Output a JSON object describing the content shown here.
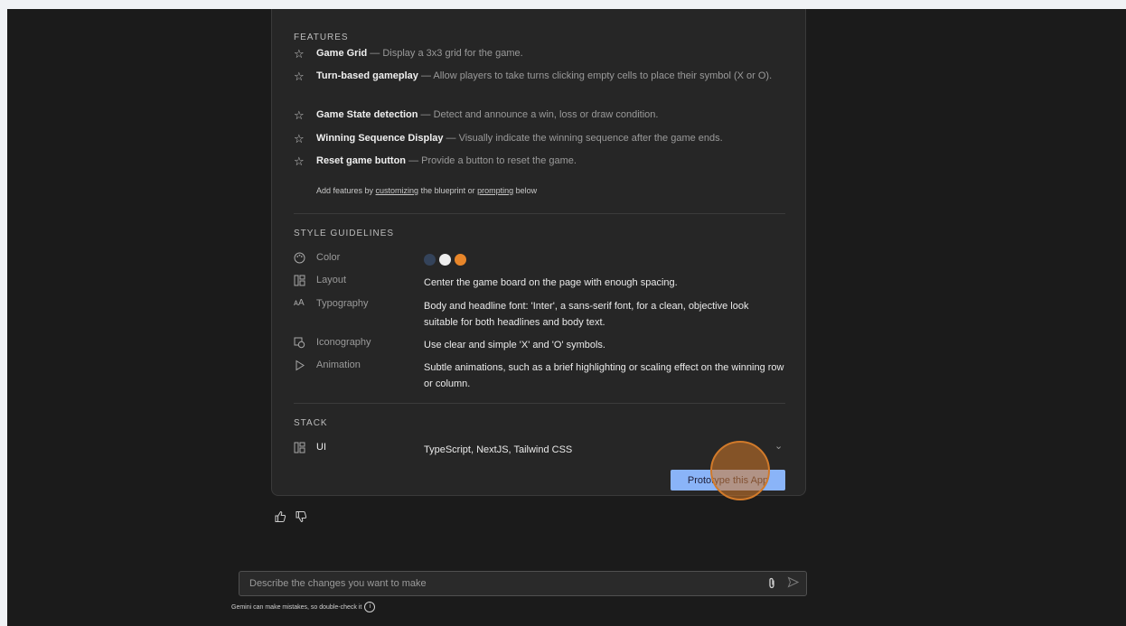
{
  "features": {
    "title": "FEATURES",
    "items": [
      {
        "name": "Game Grid",
        "desc": " — Display a 3x3 grid for the game."
      },
      {
        "name": "Turn-based gameplay",
        "desc": " — Allow players to take turns clicking empty cells to place their symbol (X or O)."
      },
      {
        "name": "Game State detection",
        "desc": " — Detect and announce a win, loss or draw condition."
      },
      {
        "name": "Winning Sequence Display",
        "desc": " — Visually indicate the winning sequence after the game ends."
      },
      {
        "name": "Reset game button",
        "desc": " — Provide a button to reset the game."
      }
    ],
    "hint_prefix": "Add features by ",
    "hint_link1": "customizing",
    "hint_middle": " the blueprint or ",
    "hint_link2": "prompting",
    "hint_suffix": " below"
  },
  "style": {
    "title": "STYLE GUIDELINES",
    "color_label": "Color",
    "colors": [
      "#34435a",
      "#eeeeee",
      "#e8862a"
    ],
    "layout_label": "Layout",
    "layout_value": "Center the game board on the page with enough spacing.",
    "typography_label": "Typography",
    "typography_value": "Body and headline font: 'Inter', a sans-serif font, for a clean, objective look suitable for both headlines and body text.",
    "iconography_label": "Iconography",
    "iconography_value": "Use clear and simple 'X' and 'O' symbols.",
    "animation_label": "Animation",
    "animation_value": "Subtle animations, such as a brief highlighting or scaling effect on the winning row or column.",
    "typography_icon_glyph": "ᴀA"
  },
  "stack": {
    "title": "STACK",
    "ui_label": "UI",
    "ui_value": "TypeScript, NextJS, Tailwind CSS"
  },
  "prototype_button": "Prototype this App",
  "input": {
    "placeholder": "Describe the changes you want to make"
  },
  "disclaimer": "Gemini can make mistakes, so double-check it"
}
